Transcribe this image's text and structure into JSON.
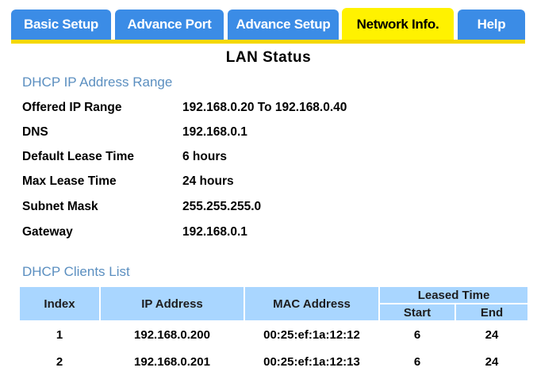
{
  "tabs": [
    {
      "label": "Basic Setup",
      "active": false
    },
    {
      "label": "Advance Port",
      "active": false
    },
    {
      "label": "Advance Setup",
      "active": false
    },
    {
      "label": "Network Info.",
      "active": true
    },
    {
      "label": "Help",
      "active": false
    }
  ],
  "colors": {
    "tab_bg": "#3b8ce6",
    "tab_active_bg": "#fff200",
    "tab_underline": "#f5d800",
    "section_heading": "#5b8fc0",
    "table_header_bg": "#a9d6ff"
  },
  "page_title": "LAN Status",
  "dhcp_range": {
    "heading": "DHCP IP Address Range",
    "rows": [
      {
        "label": "Offered IP Range",
        "value": "192.168.0.20 To 192.168.0.40"
      },
      {
        "label": "DNS",
        "value": "192.168.0.1"
      },
      {
        "label": "Default Lease Time",
        "value": "6 hours"
      },
      {
        "label": "Max Lease Time",
        "value": "24 hours"
      },
      {
        "label": "Subnet Mask",
        "value": "255.255.255.0"
      },
      {
        "label": "Gateway",
        "value": "192.168.0.1"
      }
    ]
  },
  "clients": {
    "heading": "DHCP Clients List",
    "headers": {
      "index": "Index",
      "ip": "IP Address",
      "mac": "MAC Address",
      "leased_time": "Leased Time",
      "start": "Start",
      "end": "End"
    },
    "rows": [
      {
        "index": "1",
        "ip": "192.168.0.200",
        "mac": "00:25:ef:1a:12:12",
        "start": "6",
        "end": "24"
      },
      {
        "index": "2",
        "ip": "192.168.0.201",
        "mac": "00:25:ef:1a:12:13",
        "start": "6",
        "end": "24"
      }
    ]
  }
}
